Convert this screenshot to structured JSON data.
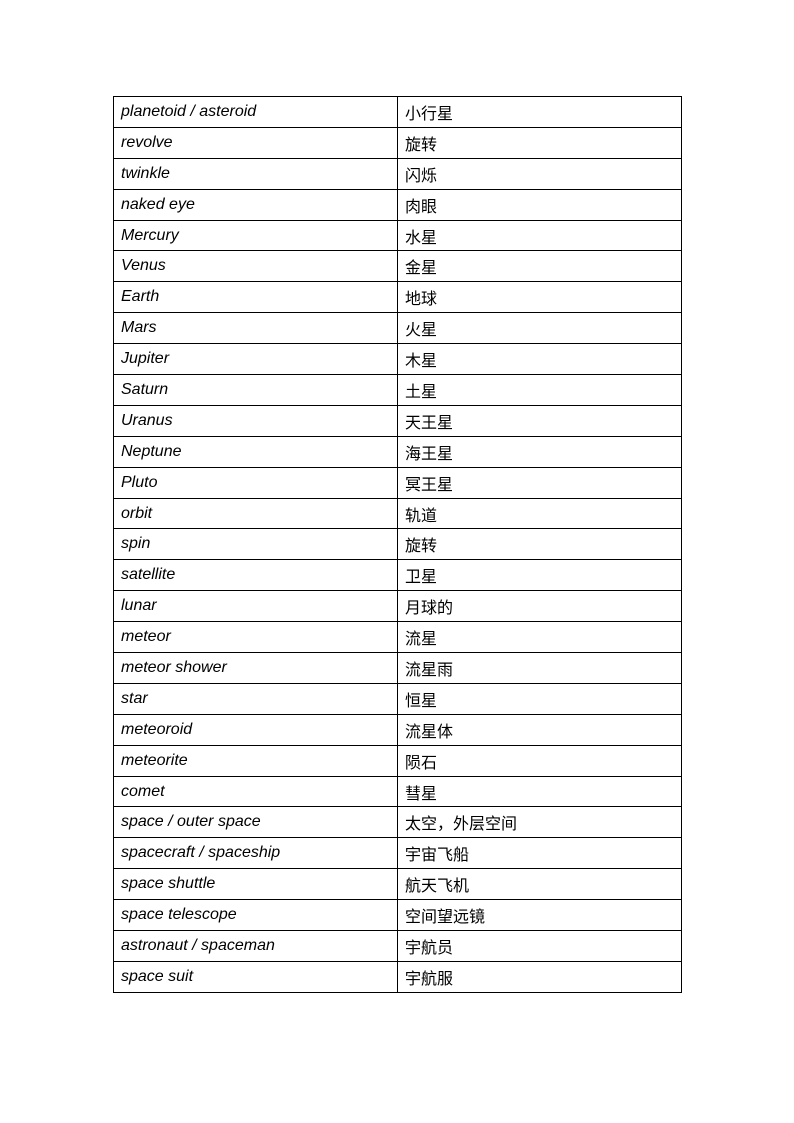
{
  "vocabulary": [
    {
      "en": "planetoid / asteroid",
      "zh": "小行星"
    },
    {
      "en": "revolve",
      "zh": "旋转"
    },
    {
      "en": "twinkle",
      "zh": "闪烁"
    },
    {
      "en": "naked eye",
      "zh": "肉眼"
    },
    {
      "en": "Mercury",
      "zh": "水星"
    },
    {
      "en": "Venus",
      "zh": "金星"
    },
    {
      "en": "Earth",
      "zh": "地球"
    },
    {
      "en": "Mars",
      "zh": "火星"
    },
    {
      "en": "Jupiter",
      "zh": "木星"
    },
    {
      "en": "Saturn",
      "zh": "土星"
    },
    {
      "en": "Uranus",
      "zh": "天王星"
    },
    {
      "en": "Neptune",
      "zh": "海王星"
    },
    {
      "en": "Pluto",
      "zh": "冥王星"
    },
    {
      "en": "orbit",
      "zh": "轨道"
    },
    {
      "en": "spin",
      "zh": "旋转"
    },
    {
      "en": "satellite",
      "zh": "卫星"
    },
    {
      "en": "lunar",
      "zh": "月球的"
    },
    {
      "en": "meteor",
      "zh": "流星"
    },
    {
      "en": "meteor shower",
      "zh": "流星雨"
    },
    {
      "en": "star",
      "zh": "恒星"
    },
    {
      "en": "meteoroid",
      "zh": "流星体"
    },
    {
      "en": "meteorite",
      "zh": "陨石"
    },
    {
      "en": "comet",
      "zh": "彗星"
    },
    {
      "en": "space / outer space",
      "zh": "太空，外层空间"
    },
    {
      "en": "spacecraft / spaceship",
      "zh": "宇宙飞船"
    },
    {
      "en": "space shuttle",
      "zh": "航天飞机"
    },
    {
      "en": "space telescope",
      "zh": "空间望远镜"
    },
    {
      "en": "astronaut / spaceman",
      "zh": "宇航员"
    },
    {
      "en": "space suit",
      "zh": "宇航服"
    }
  ]
}
